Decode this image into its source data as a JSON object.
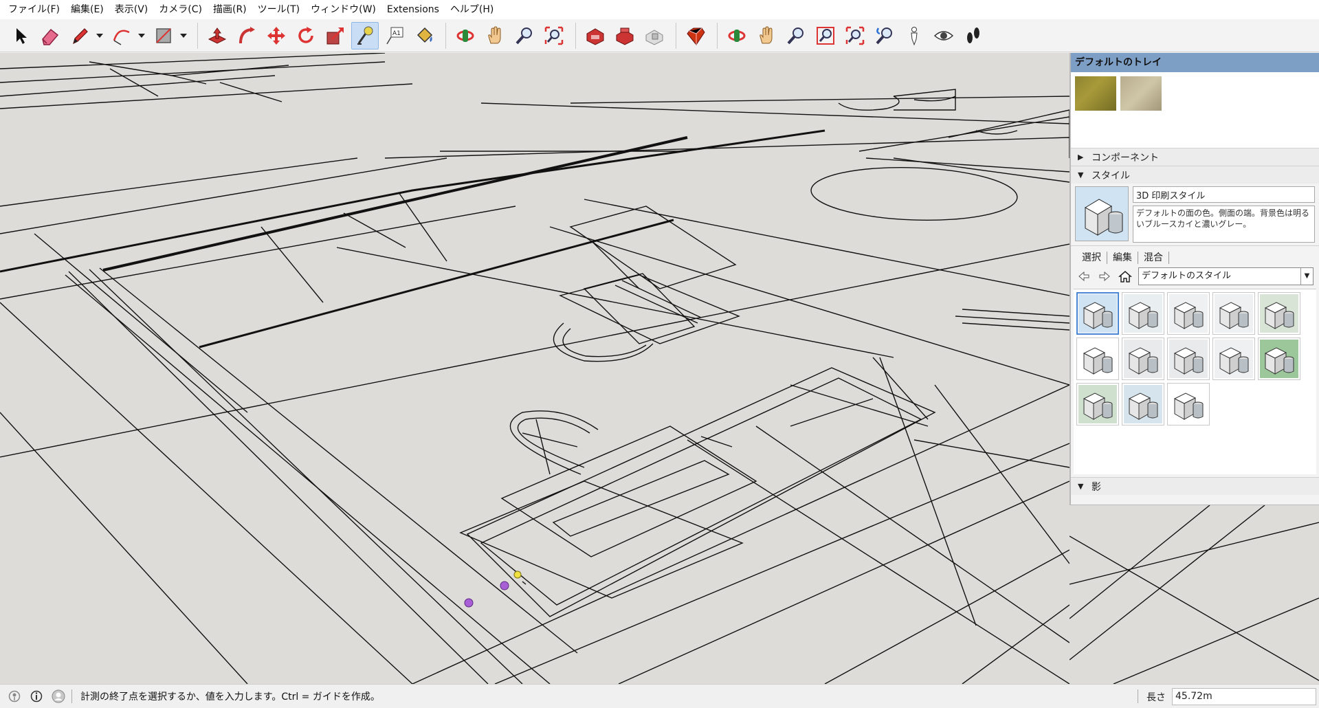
{
  "menu": [
    {
      "label": "ファイル(F)"
    },
    {
      "label": "編集(E)"
    },
    {
      "label": "表示(V)"
    },
    {
      "label": "カメラ(C)"
    },
    {
      "label": "描画(R)"
    },
    {
      "label": "ツール(T)"
    },
    {
      "label": "ウィンドウ(W)"
    },
    {
      "label": "Extensions"
    },
    {
      "label": "ヘルプ(H)"
    }
  ],
  "toolbar": {
    "active_tool": "tape-measure",
    "accent_color": "#c9def5"
  },
  "tray": {
    "title": "デフォルトのトレイ",
    "sections": {
      "components": {
        "label": "コンポーネント",
        "expanded": false
      },
      "styles": {
        "label": "スタイル",
        "expanded": true
      },
      "shadows": {
        "label": "影",
        "expanded": true
      }
    },
    "style": {
      "name": "3D 印刷スタイル",
      "description": "デフォルトの面の色。側面の端。背景色は明るいブルースカイと濃いグレー。"
    },
    "tabs": [
      {
        "label": "選択"
      },
      {
        "label": "編集"
      },
      {
        "label": "混合"
      }
    ],
    "collection": "デフォルトのスタイル"
  },
  "status": {
    "message": "計測の終了点を選択するか、値を入力します。Ctrl = ガイドを作成。",
    "measure_label": "長さ",
    "measure_value": "45.72m"
  }
}
